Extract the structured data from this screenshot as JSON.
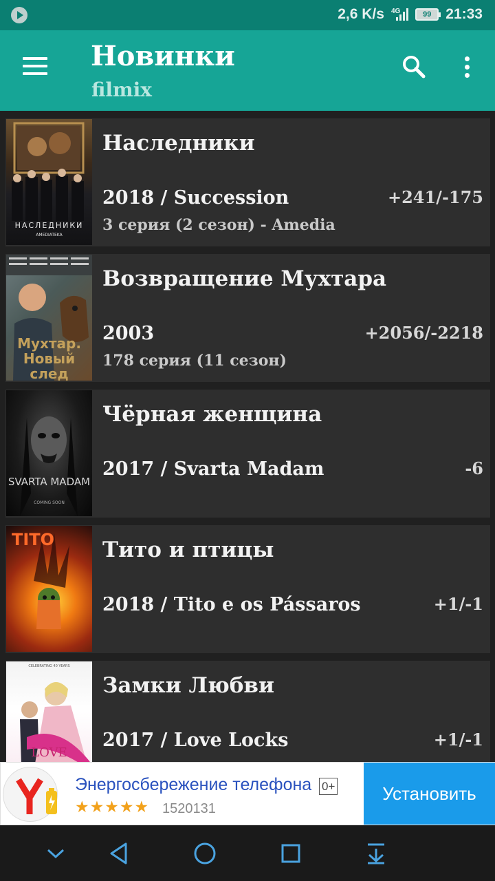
{
  "status_bar": {
    "speed": "2,6 K/s",
    "network": "4G",
    "battery": "99",
    "time": "21:33",
    "icons": [
      "play-icon",
      "signal-icon",
      "battery-icon"
    ]
  },
  "app_bar": {
    "title": "Новинки",
    "subtitle": "filmix",
    "icons": [
      "menu-icon",
      "search-icon",
      "more-vert-icon"
    ]
  },
  "items": [
    {
      "title": "Наследники",
      "year_line": "2018 / Succession",
      "episode": "3 серия (2 сезон) - Amedia",
      "rating": "+241/-175",
      "poster_text": "НАСЛЕДНИКИ",
      "poster_sub": "AMEDIATEKA"
    },
    {
      "title": "Возвращение Мухтара",
      "year_line": "2003",
      "episode": "178 серия (11 сезон)",
      "rating": "+2056/-2218",
      "poster_text": "Мухтар. Новый след"
    },
    {
      "title": "Чёрная женщина",
      "year_line": "2017 / Svarta Madam",
      "episode": "",
      "rating": "-6",
      "poster_text": "SVARTA MADAM",
      "poster_sub": "COMING SOON"
    },
    {
      "title": "Тито и птицы",
      "year_line": "2018 / Tito e os Pássaros",
      "episode": "",
      "rating": "+1/-1",
      "poster_text": "TITO"
    },
    {
      "title": "Замки Любви",
      "year_line": "2017 / Love Locks",
      "episode": "",
      "rating": "+1/-1",
      "poster_text": "LOVE",
      "poster_sub": "CELEBRATING 40 YEARS"
    }
  ],
  "ad": {
    "title": "Энергосбережение телефона",
    "age": "0+",
    "stars": "★★★★★",
    "count": "1520131",
    "install": "Установить"
  },
  "nav_bar": {
    "icons": [
      "chevron-down-icon",
      "back-icon",
      "home-icon",
      "recents-icon",
      "download-icon"
    ]
  },
  "colors": {
    "status_bar": "#0b7f72",
    "app_bar": "#16a596",
    "card": "#2e2e2e",
    "accent_install": "#1a9bea"
  }
}
